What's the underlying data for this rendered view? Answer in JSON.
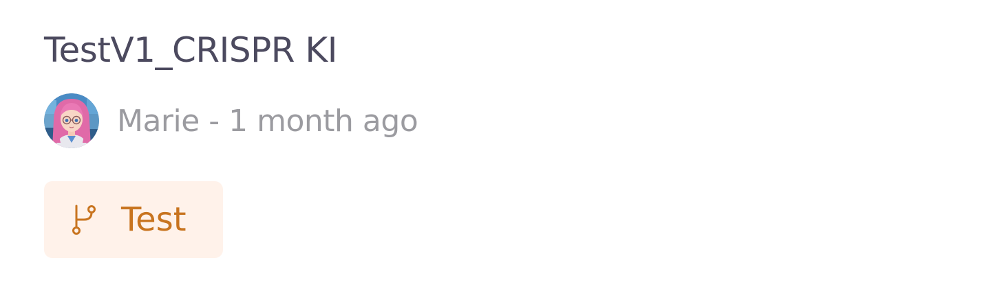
{
  "item": {
    "title": "TestV1_CRISPR KI",
    "author": "Marie",
    "separator": "-",
    "time_ago": "1 month ago",
    "author_line": "Marie - 1 month ago"
  },
  "branch": {
    "label": "Test",
    "icon": "git-branch-icon",
    "text_color": "#c8741f",
    "background_color": "#fff2ea"
  },
  "avatar": {
    "icon": "avatar"
  },
  "colors": {
    "title": "#4c4a5f",
    "meta": "#9b9ba0"
  }
}
